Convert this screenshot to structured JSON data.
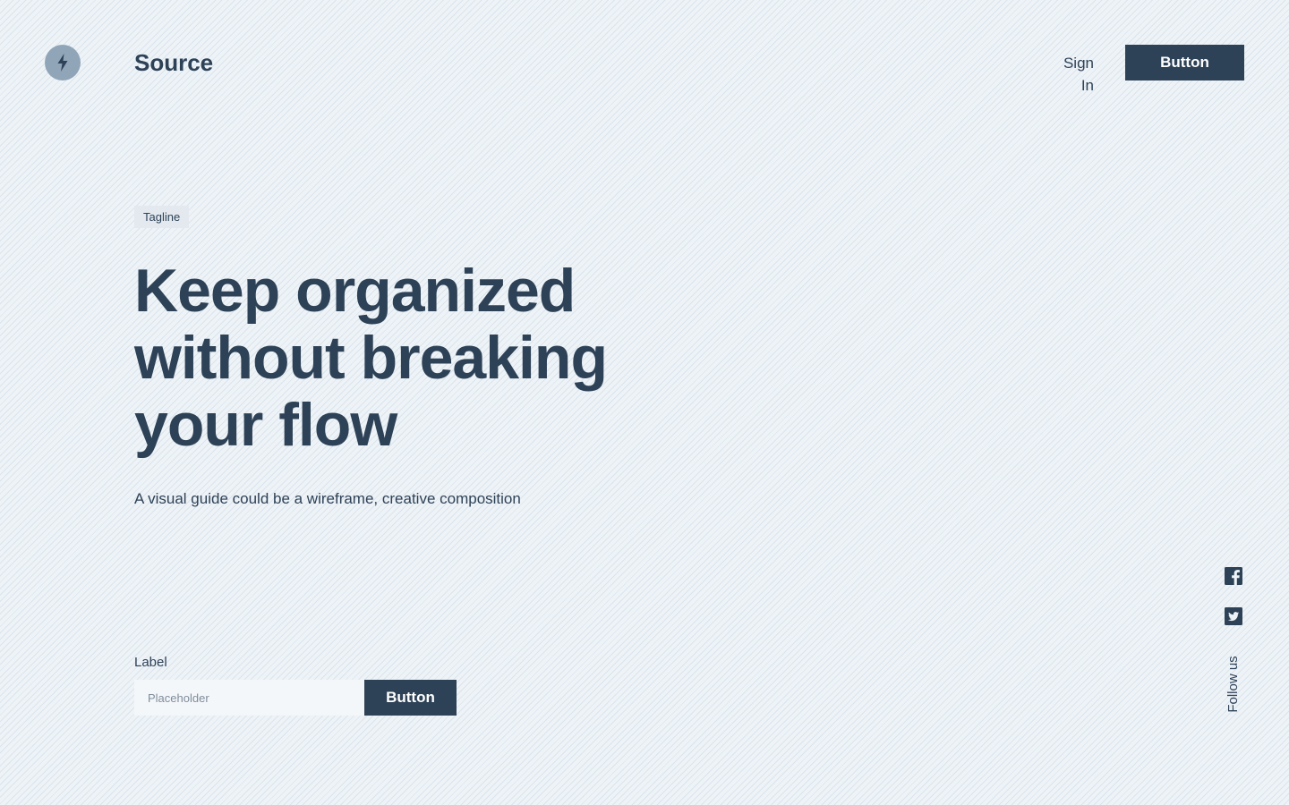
{
  "header": {
    "logo_icon": "lightning-bolt-icon",
    "brand": "Source",
    "signin_label": "Sign In",
    "button_label": "Button"
  },
  "hero": {
    "tagline": "Tagline",
    "headline": "Keep organized without breaking your flow",
    "subhead": "A visual guide could be a wireframe, creative composition"
  },
  "form": {
    "label": "Label",
    "placeholder": "Placeholder",
    "value": "",
    "button_label": "Button"
  },
  "social": {
    "icons": [
      "facebook-icon",
      "twitter-icon"
    ],
    "follow_label": "Follow us"
  },
  "colors": {
    "primary": "#2e4257",
    "logo_circle": "#90a5b8",
    "background": "#eef3f7",
    "input_background": "#f4f7fa"
  }
}
